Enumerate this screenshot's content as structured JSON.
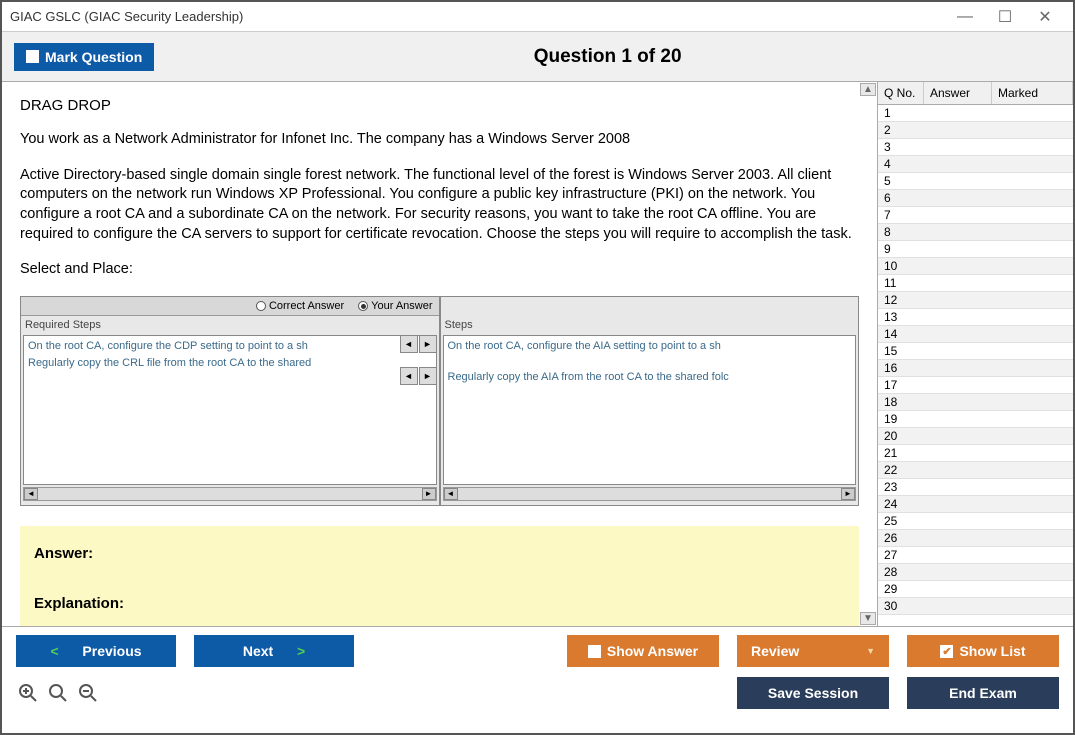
{
  "window": {
    "title": "GIAC GSLC (GIAC Security Leadership)"
  },
  "header": {
    "mark_label": "Mark Question",
    "question_title": "Question 1 of 20"
  },
  "question": {
    "type": "DRAG DROP",
    "intro": "You work as a Network Administrator for Infonet Inc. The company has a Windows Server 2008",
    "body": "Active Directory-based single domain single forest network. The functional level of the forest is Windows Server 2003. All client computers on the network run Windows XP Professional. You configure a public key infrastructure (PKI) on the network. You configure a root CA and a subordinate CA on the network. For security reasons, you want to take the root CA offline. You are required to configure the CA servers to support for certificate revocation. Choose the steps you will require to accomplish the task.",
    "select": "Select and Place:",
    "radio_correct": "Correct Answer",
    "radio_your": "Your Answer",
    "left_label": "Required Steps",
    "right_label": "Steps",
    "left_step1": "On the root CA, configure the CDP setting to point to a sh",
    "left_step2": "Regularly copy the CRL file from the root CA to the shared",
    "right_step1": "On the root CA, configure the AIA setting to point to a sh",
    "right_step2": "Regularly copy the AIA from the root CA to the shared folc"
  },
  "answer": {
    "answer_label": "Answer:",
    "explanation_label": "Explanation:"
  },
  "sidebar": {
    "col_qno": "Q No.",
    "col_answer": "Answer",
    "col_marked": "Marked",
    "rows": [
      "1",
      "2",
      "3",
      "4",
      "5",
      "6",
      "7",
      "8",
      "9",
      "10",
      "11",
      "12",
      "13",
      "14",
      "15",
      "16",
      "17",
      "18",
      "19",
      "20",
      "21",
      "22",
      "23",
      "24",
      "25",
      "26",
      "27",
      "28",
      "29",
      "30"
    ]
  },
  "footer": {
    "previous": "Previous",
    "next": "Next",
    "show_answer": "Show Answer",
    "review": "Review",
    "show_list": "Show List",
    "save_session": "Save Session",
    "end_exam": "End Exam"
  }
}
